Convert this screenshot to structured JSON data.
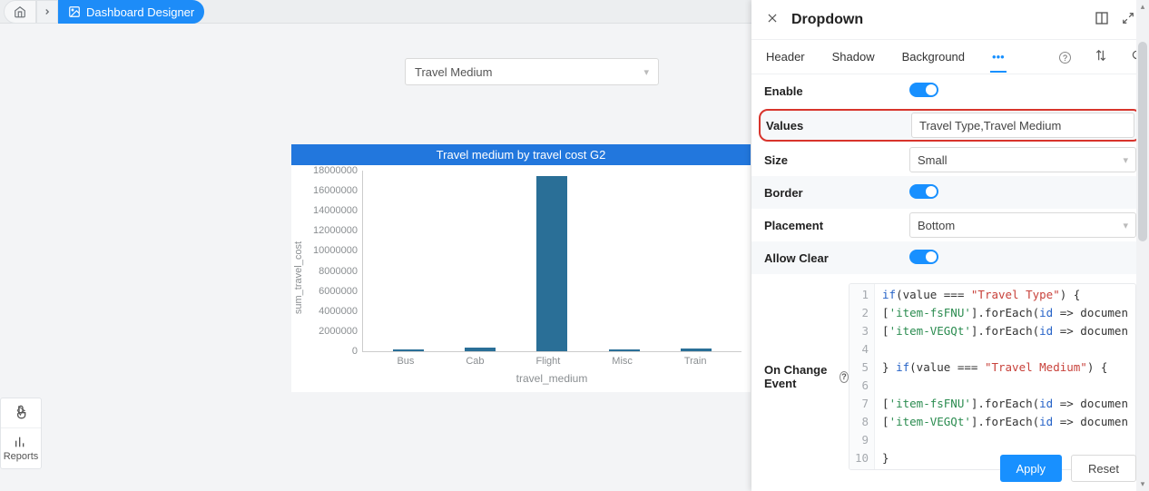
{
  "breadcrumb": {
    "current": "Dashboard Designer"
  },
  "sideTools": {
    "reports_label": "Reports"
  },
  "canvas": {
    "dropdown": {
      "selected": "Travel Medium"
    }
  },
  "chart_data": {
    "type": "bar",
    "title": "Travel medium by travel cost G2",
    "xlabel": "travel_medium",
    "ylabel": "sum_travel_cost",
    "ylim": [
      0,
      18000000
    ],
    "yticks": [
      0,
      2000000,
      4000000,
      6000000,
      8000000,
      10000000,
      12000000,
      14000000,
      16000000,
      18000000
    ],
    "categories": [
      "Bus",
      "Cab",
      "Flight",
      "Misc",
      "Train"
    ],
    "values": [
      200000,
      400000,
      17500000,
      200000,
      250000
    ]
  },
  "panel": {
    "title": "Dropdown",
    "tabs": {
      "header": "Header",
      "shadow": "Shadow",
      "background": "Background",
      "more": "•••"
    },
    "rows": {
      "enable": "Enable",
      "values": "Values",
      "values_val": "Travel Type,Travel Medium",
      "size": "Size",
      "size_val": "Small",
      "border": "Border",
      "placement": "Placement",
      "placement_val": "Bottom",
      "allow_clear": "Allow Clear",
      "on_change": "On Change Event"
    },
    "code": {
      "lines": [
        {
          "n": 1,
          "frags": [
            {
              "t": "if",
              "c": "kw"
            },
            {
              "t": "(value === ",
              "c": "pn"
            },
            {
              "t": "\"Travel Type\"",
              "c": "str"
            },
            {
              "t": ") {",
              "c": "pn"
            }
          ]
        },
        {
          "n": 2,
          "frags": [
            {
              "t": "[",
              "c": "pn"
            },
            {
              "t": "'item-fsFNU'",
              "c": "id"
            },
            {
              "t": "].forEach(",
              "c": "pn"
            },
            {
              "t": "id",
              "c": "v"
            },
            {
              "t": " => documen",
              "c": "pn"
            }
          ]
        },
        {
          "n": 3,
          "frags": [
            {
              "t": "[",
              "c": "pn"
            },
            {
              "t": "'item-VEGQt'",
              "c": "id"
            },
            {
              "t": "].forEach(",
              "c": "pn"
            },
            {
              "t": "id",
              "c": "v"
            },
            {
              "t": " => documen",
              "c": "pn"
            }
          ]
        },
        {
          "n": 4,
          "frags": []
        },
        {
          "n": 5,
          "frags": [
            {
              "t": "} ",
              "c": "pn"
            },
            {
              "t": "if",
              "c": "kw"
            },
            {
              "t": "(value === ",
              "c": "pn"
            },
            {
              "t": "\"Travel Medium\"",
              "c": "str"
            },
            {
              "t": ") {",
              "c": "pn"
            }
          ]
        },
        {
          "n": 6,
          "frags": []
        },
        {
          "n": 7,
          "frags": [
            {
              "t": "[",
              "c": "pn"
            },
            {
              "t": "'item-fsFNU'",
              "c": "id"
            },
            {
              "t": "].forEach(",
              "c": "pn"
            },
            {
              "t": "id",
              "c": "v"
            },
            {
              "t": " => documen",
              "c": "pn"
            }
          ]
        },
        {
          "n": 8,
          "frags": [
            {
              "t": "[",
              "c": "pn"
            },
            {
              "t": "'item-VEGQt'",
              "c": "id"
            },
            {
              "t": "].forEach(",
              "c": "pn"
            },
            {
              "t": "id",
              "c": "v"
            },
            {
              "t": " => documen",
              "c": "pn"
            }
          ]
        },
        {
          "n": 9,
          "frags": []
        },
        {
          "n": 10,
          "frags": [
            {
              "t": "}",
              "c": "pn"
            }
          ]
        }
      ]
    },
    "buttons": {
      "apply": "Apply",
      "reset": "Reset"
    }
  }
}
